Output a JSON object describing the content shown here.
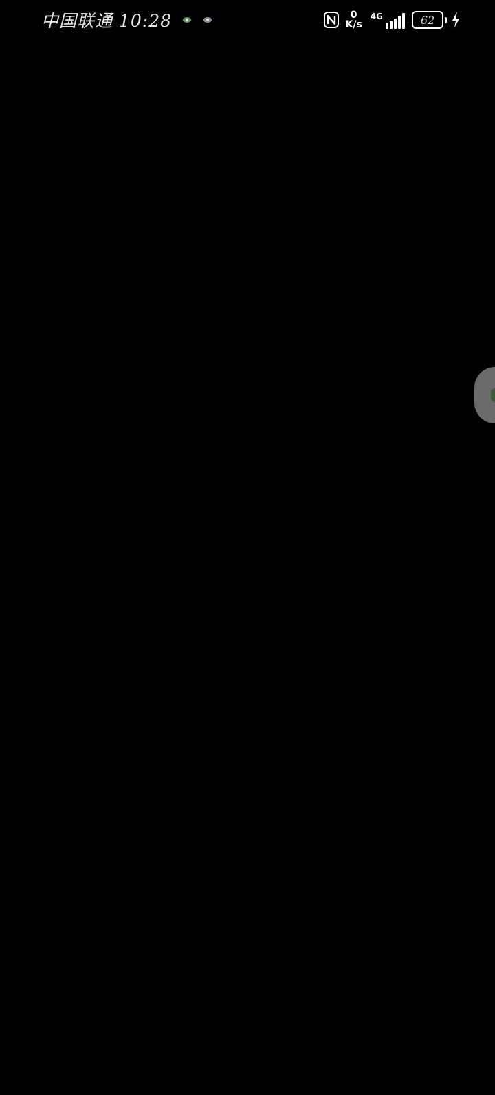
{
  "status_bar": {
    "carrier": "中国联通",
    "time": "10:28",
    "notification_icons": [
      "app-notification-icon",
      "app-notification-icon"
    ],
    "net_speed_value": "0",
    "net_speed_unit": "K/s",
    "network_type": "4G",
    "signal_level": 5,
    "battery_level": "62",
    "charging": true
  },
  "colors": {
    "background": "#000000",
    "floating_ball": "#6b6b6b",
    "status_text": "#ffffff"
  }
}
